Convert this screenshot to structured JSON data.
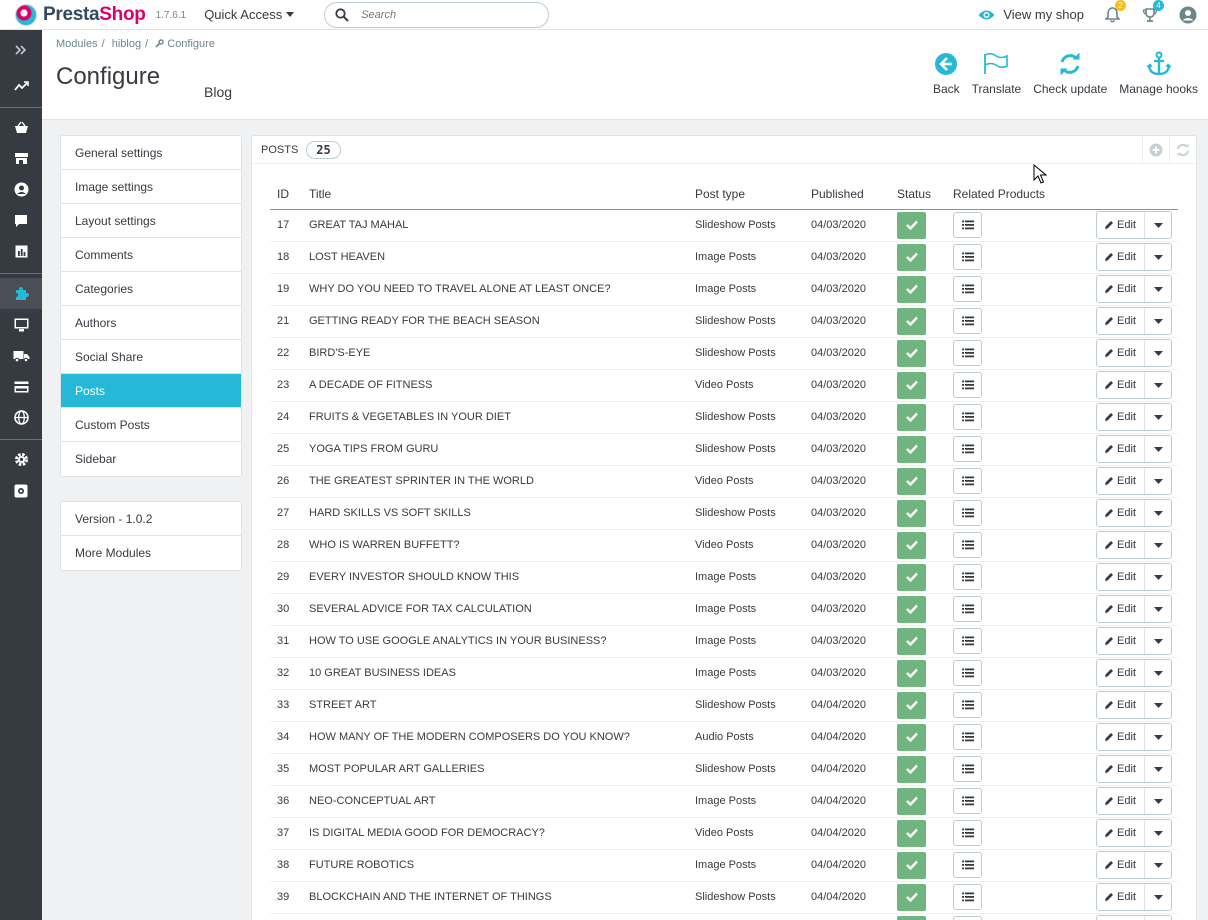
{
  "header": {
    "brand_first": "Presta",
    "brand_second": "Shop",
    "version": "1.7.6.1",
    "quick_access": "Quick Access",
    "search_placeholder": "Search",
    "view_shop": "View my shop",
    "orders_badge": "2",
    "customers_badge": "4"
  },
  "breadcrumb": {
    "items": [
      "Modules",
      "hiblog",
      "Configure"
    ]
  },
  "page": {
    "title": "Configure",
    "subtitle": "Blog"
  },
  "toolbar": {
    "back": "Back",
    "translate": "Translate",
    "check_update": "Check update",
    "manage_hooks": "Manage hooks"
  },
  "settings_menu": {
    "items": [
      "General settings",
      "Image settings",
      "Layout settings",
      "Comments",
      "Categories",
      "Authors",
      "Social Share",
      "Posts",
      "Custom Posts",
      "Sidebar"
    ],
    "active": "Posts"
  },
  "info_menu": {
    "version": "Version - 1.0.2",
    "more": "More Modules"
  },
  "posts": {
    "title": "Posts",
    "count": "25",
    "columns": {
      "id": "ID",
      "title": "Title",
      "type": "Post type",
      "published": "Published",
      "status": "Status",
      "related": "Related Products"
    },
    "edit_label": "Edit",
    "rows": [
      {
        "id": "17",
        "title": "GREAT TAJ MAHAL",
        "type": "Slideshow Posts",
        "date": "04/03/2020"
      },
      {
        "id": "18",
        "title": "LOST HEAVEN",
        "type": "Image Posts",
        "date": "04/03/2020"
      },
      {
        "id": "19",
        "title": "WHY DO YOU NEED TO TRAVEL ALONE AT LEAST ONCE?",
        "type": "Image Posts",
        "date": "04/03/2020"
      },
      {
        "id": "21",
        "title": "GETTING READY FOR THE BEACH SEASON",
        "type": "Slideshow Posts",
        "date": "04/03/2020"
      },
      {
        "id": "22",
        "title": "BIRD'S-EYE",
        "type": "Slideshow Posts",
        "date": "04/03/2020"
      },
      {
        "id": "23",
        "title": "A DECADE OF FITNESS",
        "type": "Video Posts",
        "date": "04/03/2020"
      },
      {
        "id": "24",
        "title": "FRUITS & VEGETABLES IN YOUR DIET",
        "type": "Slideshow Posts",
        "date": "04/03/2020"
      },
      {
        "id": "25",
        "title": "YOGA TIPS FROM GURU",
        "type": "Slideshow Posts",
        "date": "04/03/2020"
      },
      {
        "id": "26",
        "title": "THE GREATEST SPRINTER IN THE WORLD",
        "type": "Video Posts",
        "date": "04/03/2020"
      },
      {
        "id": "27",
        "title": "HARD SKILLS VS SOFT SKILLS",
        "type": "Slideshow Posts",
        "date": "04/03/2020"
      },
      {
        "id": "28",
        "title": "WHO IS WARREN BUFFETT?",
        "type": "Video Posts",
        "date": "04/03/2020"
      },
      {
        "id": "29",
        "title": "EVERY INVESTOR SHOULD KNOW THIS",
        "type": "Image Posts",
        "date": "04/03/2020"
      },
      {
        "id": "30",
        "title": "SEVERAL ADVICE FOR TAX CALCULATION",
        "type": "Image Posts",
        "date": "04/03/2020"
      },
      {
        "id": "31",
        "title": "HOW TO USE GOOGLE ANALYTICS IN YOUR BUSINESS?",
        "type": "Image Posts",
        "date": "04/03/2020"
      },
      {
        "id": "32",
        "title": "10 GREAT BUSINESS IDEAS",
        "type": "Image Posts",
        "date": "04/03/2020"
      },
      {
        "id": "33",
        "title": "STREET ART",
        "type": "Slideshow Posts",
        "date": "04/04/2020"
      },
      {
        "id": "34",
        "title": "HOW MANY OF THE MODERN COMPOSERS DO YOU KNOW?",
        "type": "Audio Posts",
        "date": "04/04/2020"
      },
      {
        "id": "35",
        "title": "MOST POPULAR ART GALLERIES",
        "type": "Slideshow Posts",
        "date": "04/04/2020"
      },
      {
        "id": "36",
        "title": "NEO-CONCEPTUAL ART",
        "type": "Image Posts",
        "date": "04/04/2020"
      },
      {
        "id": "37",
        "title": "IS DIGITAL MEDIA GOOD FOR DEMOCRACY?",
        "type": "Video Posts",
        "date": "04/04/2020"
      },
      {
        "id": "38",
        "title": "FUTURE ROBOTICS",
        "type": "Image Posts",
        "date": "04/04/2020"
      },
      {
        "id": "39",
        "title": "BLOCKCHAIN AND THE INTERNET OF THINGS",
        "type": "Slideshow Posts",
        "date": "04/04/2020"
      },
      {
        "id": "",
        "title": "",
        "type": "",
        "date": ""
      }
    ]
  },
  "colors": {
    "accent": "#25b9d7",
    "status_green": "#70b580",
    "sidebar_dark": "#363a41",
    "brand_pink": "#df0067"
  },
  "icons": [
    "chevrons-right-icon",
    "trending-icon",
    "basket-icon",
    "store-icon",
    "user-icon",
    "chat-icon",
    "chart-icon",
    "puzzle-icon",
    "monitor-icon",
    "truck-icon",
    "card-icon",
    "globe-icon",
    "gear-icon",
    "advanced-gear-icon"
  ]
}
